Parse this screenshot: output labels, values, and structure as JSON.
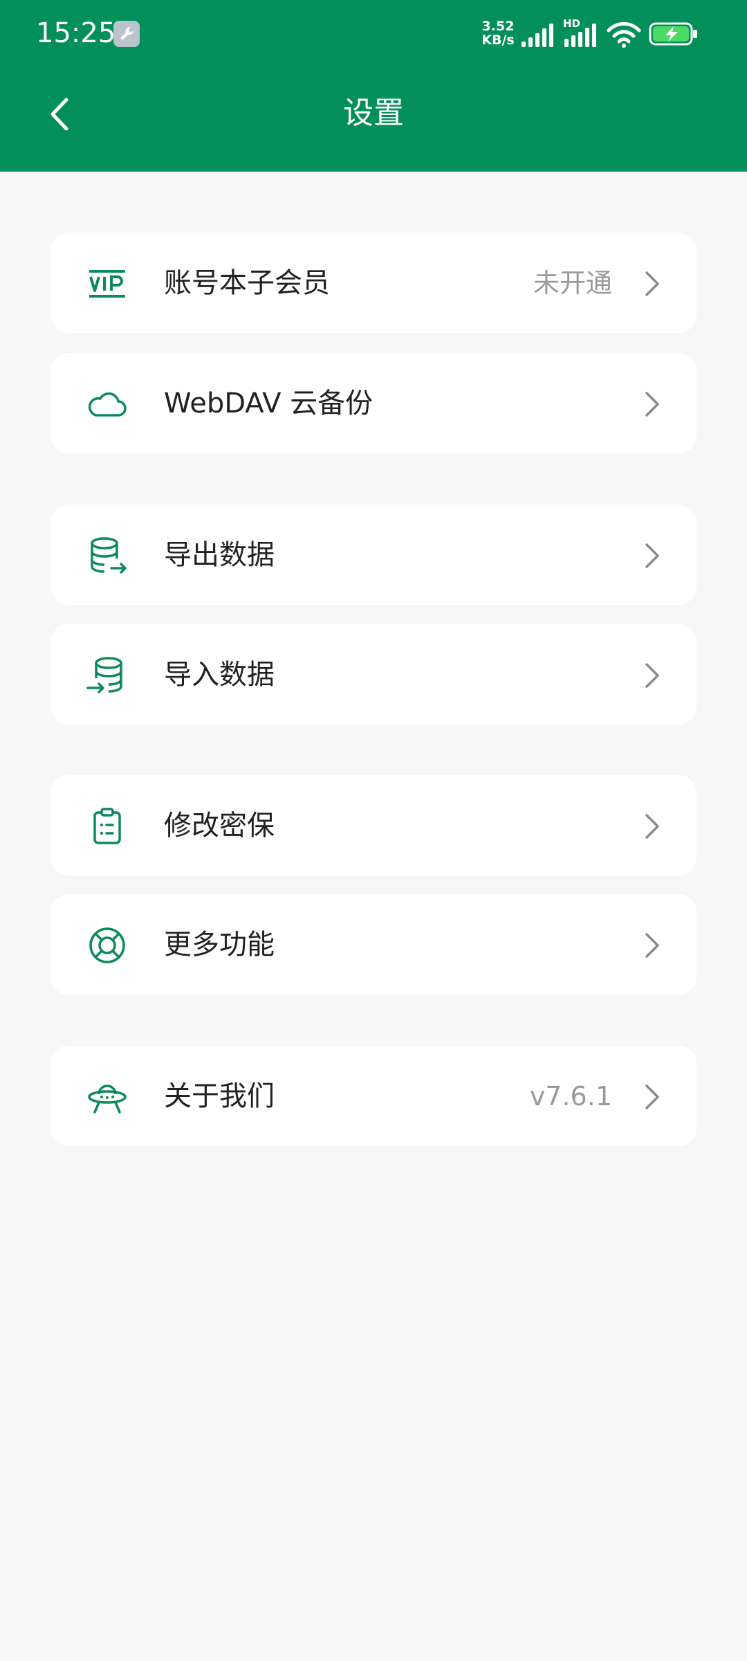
{
  "status_bar": {
    "time": "15:25",
    "net_speed_value": "3.52",
    "net_speed_unit": "KB/s",
    "network_type": "HD"
  },
  "header": {
    "title": "设置"
  },
  "colors": {
    "brand": "#038f59",
    "background": "#f7f7f7",
    "card": "#ffffff",
    "icon": "#0d8a5a"
  },
  "items": [
    {
      "icon": "vip-icon",
      "label": "账号本子会员",
      "value": "未开通"
    },
    {
      "icon": "cloud-icon",
      "label": "WebDAV 云备份",
      "value": ""
    },
    {
      "icon": "database-export-icon",
      "label": "导出数据",
      "value": ""
    },
    {
      "icon": "database-import-icon",
      "label": "导入数据",
      "value": ""
    },
    {
      "icon": "clipboard-icon",
      "label": "修改密保",
      "value": ""
    },
    {
      "icon": "lifebuoy-icon",
      "label": "更多功能",
      "value": ""
    },
    {
      "icon": "ufo-icon",
      "label": "关于我们",
      "value": "v7.6.1"
    }
  ]
}
